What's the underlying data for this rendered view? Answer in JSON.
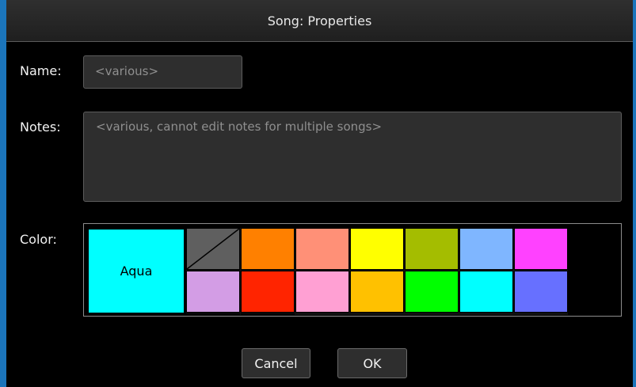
{
  "dialog": {
    "title": "Song: Properties"
  },
  "form": {
    "name_label": "Name:",
    "name_value": "<various>",
    "notes_label": "Notes:",
    "notes_value": "<various, cannot edit notes for multiple songs>",
    "color_label": "Color:"
  },
  "palette": {
    "selected": {
      "label": "Aqua",
      "color": "#00ffff"
    },
    "swatches": [
      {
        "color": "none",
        "icon": "no-color-diagonal-icon"
      },
      {
        "color": "#ff8000"
      },
      {
        "color": "#ff9077"
      },
      {
        "color": "#ffff00"
      },
      {
        "color": "#a4bd00"
      },
      {
        "color": "#7fb6ff"
      },
      {
        "color": "#ff41ff"
      },
      {
        "color": "#d39de5"
      },
      {
        "color": "#ff2400"
      },
      {
        "color": "#ffa0d3"
      },
      {
        "color": "#ffc100"
      },
      {
        "color": "#00ff00"
      },
      {
        "color": "#00ffff"
      },
      {
        "color": "#6770ff"
      },
      {
        "color": "#b96dff"
      },
      {
        "color": "#c0c0c0"
      }
    ]
  },
  "buttons": {
    "cancel": "Cancel",
    "ok": "OK"
  }
}
